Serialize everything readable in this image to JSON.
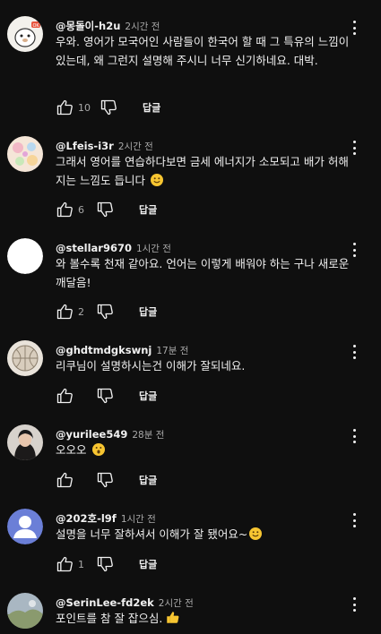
{
  "comments": [
    {
      "author": "@몽돌이-h2u",
      "time": "2시간 전",
      "text": "우와. 영어가 모국어인 사람들이 한국어 할 때 그 특유의 느낌이 있는데, 왜 그런지 설명해 주시니 너무 신기하네요. 대박.",
      "likes": "10",
      "reply_label": "답글",
      "avatar_icon": "cartoon-character-avatar-icon"
    },
    {
      "author": "@Lfeis-i3r",
      "time": "2시간 전",
      "text": "그래서 영어를 연습하다보면 금세 에너지가 소모되고 배가 허해지는 느낌도 듭니다",
      "emoji": "smiling-face-emoji",
      "likes": "6",
      "reply_label": "답글",
      "avatar_icon": "pastel-pattern-avatar-icon"
    },
    {
      "author": "@stellar9670",
      "time": "1시간 전",
      "text": "와 볼수록 천재 같아요. 언어는 이렇게 배워야 하는 구나 새로운 깨달음!",
      "likes": "2",
      "reply_label": "답글",
      "avatar_icon": "white-circle-avatar-icon"
    },
    {
      "author": "@ghdtmdgkswnj",
      "time": "17분 전",
      "text": "리쿠님이 설명하시는건 이해가 잘되네요.",
      "likes": "",
      "reply_label": "답글",
      "avatar_icon": "basketball-sketch-avatar-icon"
    },
    {
      "author": "@yurilee549",
      "time": "28분 전",
      "text": "오오오",
      "emoji": "astonished-face-emoji",
      "likes": "",
      "reply_label": "답글",
      "avatar_icon": "person-portrait-avatar-icon"
    },
    {
      "author": "@202호-l9f",
      "time": "1시간 전",
      "text": "설명을 너무 잘하셔서 이해가 잘 됐어요~",
      "emoji": "smiling-face-emoji",
      "likes": "1",
      "reply_label": "답글",
      "avatar_icon": "default-person-avatar-icon"
    },
    {
      "author": "@SerinLee-fd2ek",
      "time": "2시간 전",
      "text": "포인트를 참 잘 잡으심.",
      "emoji": "thumbs-up-emoji",
      "likes": "",
      "reply_label": "답글",
      "avatar_icon": "landscape-photo-avatar-icon"
    }
  ],
  "colors": {
    "background": "#0f0f0f",
    "text": "#f1f1f1",
    "secondary_text": "#aaaaaa",
    "emoji": "#f7c531",
    "default_avatar": "#6b7fd7"
  }
}
